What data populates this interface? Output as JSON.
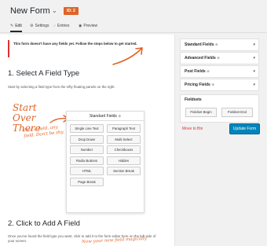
{
  "header": {
    "title": "New Form",
    "id_badge": "ID: 2"
  },
  "tabs": [
    {
      "label": "Edit",
      "icon": "pencil-icon"
    },
    {
      "label": "Settings",
      "icon": "gear-icon"
    },
    {
      "label": "Entries",
      "icon": "comments-icon"
    },
    {
      "label": "Preview",
      "icon": "eye-icon"
    }
  ],
  "notice": "This form doesn't have any fields yet. Follow the steps below to get started.",
  "step1": {
    "heading": "1. Select A Field Type",
    "description": "Start by selecting a field type from the nifty floating panels on the right."
  },
  "annotation": {
    "start_over": "Start Over There",
    "pick_field": "Pick a field, any field. Don't be shy.",
    "new_field": "Now your new field magically"
  },
  "fields_panel": {
    "title": "Standard Fields",
    "buttons": [
      "Single Line Text",
      "Paragraph Text",
      "Drop Down",
      "Multi Select",
      "Number",
      "Checkboxes",
      "Radio Buttons",
      "Hidden",
      "HTML",
      "Section Break",
      "Page Break"
    ]
  },
  "step2": {
    "heading": "2. Click to Add A Field",
    "description": "Once you've found the field type you want, click to add it to the form editor here on the left side of your screen."
  },
  "sidebar": {
    "boxes": [
      {
        "label": "Standard Fields"
      },
      {
        "label": "Advanced Fields"
      },
      {
        "label": "Post Fields"
      },
      {
        "label": "Pricing Fields"
      }
    ],
    "fieldsets": {
      "label": "Fieldsets",
      "begin": "Fieldset Begin",
      "end": "Fieldset End"
    },
    "move_to_bin": "Move to Bin",
    "update_button": "Update Form"
  },
  "colors": {
    "accent": "#e06427",
    "primary": "#0085ba",
    "danger": "#dc3232"
  }
}
